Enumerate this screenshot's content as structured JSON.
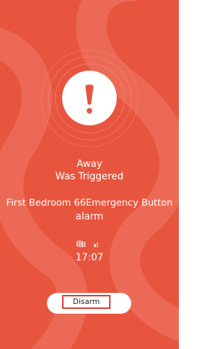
{
  "alarm": {
    "mode": "Away",
    "status": "Was Triggered",
    "device_line1": "First Bedroom 66Emergency Button",
    "device_line2": "alarm",
    "time": "17:07"
  },
  "actions": {
    "disarm_label": "Disarm"
  },
  "icons": {
    "alert": "exclamation-alert-icon"
  },
  "colors": {
    "background": "#e8553f",
    "pattern": "#ec6a55",
    "alert_symbol": "#e8553f",
    "button_bg": "#ffffff",
    "button_outline": "#d93a2b"
  }
}
